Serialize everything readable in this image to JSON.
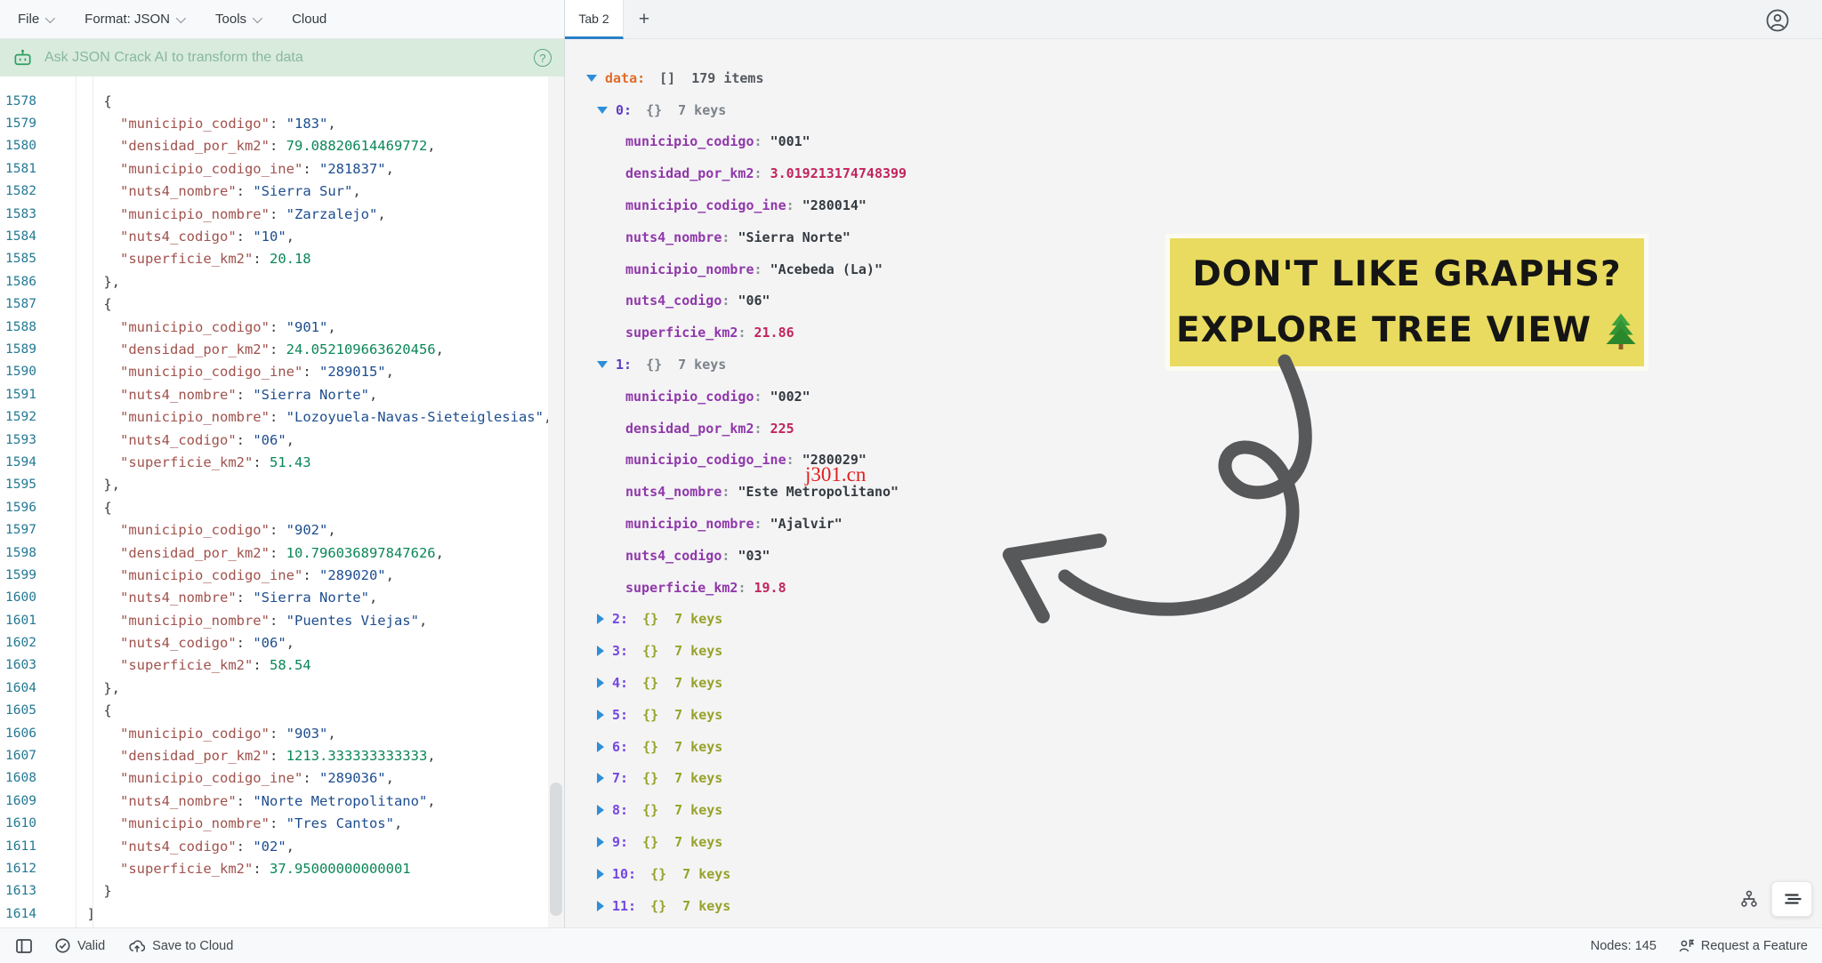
{
  "menu": {
    "items": [
      {
        "label": "File",
        "chevron": true
      },
      {
        "label": "Format: JSON",
        "chevron": true
      },
      {
        "label": "Tools",
        "chevron": true
      },
      {
        "label": "Cloud",
        "chevron": false
      }
    ]
  },
  "ai_banner": {
    "label": "Ask JSON Crack AI to transform the data",
    "help": "?"
  },
  "tabs": {
    "active": "Tab 2",
    "add": "+"
  },
  "editor": {
    "lines": [
      {
        "n": 1578,
        "p": "    {"
      },
      {
        "n": 1579,
        "k": "municipio_codigo",
        "v": "183",
        "t": "s",
        "c": true
      },
      {
        "n": 1580,
        "k": "densidad_por_km2",
        "v": "79.08820614469772",
        "t": "n",
        "c": true
      },
      {
        "n": 1581,
        "k": "municipio_codigo_ine",
        "v": "281837",
        "t": "s",
        "c": true
      },
      {
        "n": 1582,
        "k": "nuts4_nombre",
        "v": "Sierra Sur",
        "t": "s",
        "c": true
      },
      {
        "n": 1583,
        "k": "municipio_nombre",
        "v": "Zarzalejo",
        "t": "s",
        "c": true
      },
      {
        "n": 1584,
        "k": "nuts4_codigo",
        "v": "10",
        "t": "s",
        "c": true
      },
      {
        "n": 1585,
        "k": "superficie_km2",
        "v": "20.18",
        "t": "n",
        "c": false
      },
      {
        "n": 1586,
        "p": "    },"
      },
      {
        "n": 1587,
        "p": "    {"
      },
      {
        "n": 1588,
        "k": "municipio_codigo",
        "v": "901",
        "t": "s",
        "c": true
      },
      {
        "n": 1589,
        "k": "densidad_por_km2",
        "v": "24.052109663620456",
        "t": "n",
        "c": true
      },
      {
        "n": 1590,
        "k": "municipio_codigo_ine",
        "v": "289015",
        "t": "s",
        "c": true
      },
      {
        "n": 1591,
        "k": "nuts4_nombre",
        "v": "Sierra Norte",
        "t": "s",
        "c": true
      },
      {
        "n": 1592,
        "k": "municipio_nombre",
        "v": "Lozoyuela-Navas-Sieteiglesias",
        "t": "s",
        "c": true
      },
      {
        "n": 1593,
        "k": "nuts4_codigo",
        "v": "06",
        "t": "s",
        "c": true
      },
      {
        "n": 1594,
        "k": "superficie_km2",
        "v": "51.43",
        "t": "n",
        "c": false
      },
      {
        "n": 1595,
        "p": "    },"
      },
      {
        "n": 1596,
        "p": "    {"
      },
      {
        "n": 1597,
        "k": "municipio_codigo",
        "v": "902",
        "t": "s",
        "c": true
      },
      {
        "n": 1598,
        "k": "densidad_por_km2",
        "v": "10.796036897847626",
        "t": "n",
        "c": true
      },
      {
        "n": 1599,
        "k": "municipio_codigo_ine",
        "v": "289020",
        "t": "s",
        "c": true
      },
      {
        "n": 1600,
        "k": "nuts4_nombre",
        "v": "Sierra Norte",
        "t": "s",
        "c": true
      },
      {
        "n": 1601,
        "k": "municipio_nombre",
        "v": "Puentes Viejas",
        "t": "s",
        "c": true
      },
      {
        "n": 1602,
        "k": "nuts4_codigo",
        "v": "06",
        "t": "s",
        "c": true
      },
      {
        "n": 1603,
        "k": "superficie_km2",
        "v": "58.54",
        "t": "n",
        "c": false
      },
      {
        "n": 1604,
        "p": "    },"
      },
      {
        "n": 1605,
        "p": "    {"
      },
      {
        "n": 1606,
        "k": "municipio_codigo",
        "v": "903",
        "t": "s",
        "c": true
      },
      {
        "n": 1607,
        "k": "densidad_por_km2",
        "v": "1213.333333333333",
        "t": "n",
        "c": true
      },
      {
        "n": 1608,
        "k": "municipio_codigo_ine",
        "v": "289036",
        "t": "s",
        "c": true
      },
      {
        "n": 1609,
        "k": "nuts4_nombre",
        "v": "Norte Metropolitano",
        "t": "s",
        "c": true
      },
      {
        "n": 1610,
        "k": "municipio_nombre",
        "v": "Tres Cantos",
        "t": "s",
        "c": true
      },
      {
        "n": 1611,
        "k": "nuts4_codigo",
        "v": "02",
        "t": "s",
        "c": true
      },
      {
        "n": 1612,
        "k": "superficie_km2",
        "v": "37.95000000000001",
        "t": "n",
        "c": false
      },
      {
        "n": 1613,
        "p": "    }"
      },
      {
        "n": 1614,
        "p": "  ]"
      }
    ]
  },
  "tree": {
    "rows": [
      {
        "kind": "root",
        "key": "data",
        "badge": "[]",
        "meta": "179 items"
      },
      {
        "kind": "open",
        "key": "0",
        "badge": "{}",
        "meta": "7 keys"
      },
      {
        "kind": "kv",
        "key": "municipio_codigo",
        "v": "001",
        "t": "s"
      },
      {
        "kind": "kv",
        "key": "densidad_por_km2",
        "v": "3.019213174748399",
        "t": "n"
      },
      {
        "kind": "kv",
        "key": "municipio_codigo_ine",
        "v": "280014",
        "t": "s"
      },
      {
        "kind": "kv",
        "key": "nuts4_nombre",
        "v": "Sierra Norte",
        "t": "s"
      },
      {
        "kind": "kv",
        "key": "municipio_nombre",
        "v": "Acebeda (La)",
        "t": "s"
      },
      {
        "kind": "kv",
        "key": "nuts4_codigo",
        "v": "06",
        "t": "s"
      },
      {
        "kind": "kv",
        "key": "superficie_km2",
        "v": "21.86",
        "t": "n"
      },
      {
        "kind": "open",
        "key": "1",
        "badge": "{}",
        "meta": "7 keys"
      },
      {
        "kind": "kv",
        "key": "municipio_codigo",
        "v": "002",
        "t": "s"
      },
      {
        "kind": "kv",
        "key": "densidad_por_km2",
        "v": "225",
        "t": "n"
      },
      {
        "kind": "kv",
        "key": "municipio_codigo_ine",
        "v": "280029",
        "t": "s"
      },
      {
        "kind": "kv",
        "key": "nuts4_nombre",
        "v": "Este Metropolitano",
        "t": "s"
      },
      {
        "kind": "kv",
        "key": "municipio_nombre",
        "v": "Ajalvir",
        "t": "s"
      },
      {
        "kind": "kv",
        "key": "nuts4_codigo",
        "v": "03",
        "t": "s"
      },
      {
        "kind": "kv",
        "key": "superficie_km2",
        "v": "19.8",
        "t": "n"
      },
      {
        "kind": "closed",
        "key": "2",
        "badge": "{}",
        "meta": "7 keys"
      },
      {
        "kind": "closed",
        "key": "3",
        "badge": "{}",
        "meta": "7 keys"
      },
      {
        "kind": "closed",
        "key": "4",
        "badge": "{}",
        "meta": "7 keys"
      },
      {
        "kind": "closed",
        "key": "5",
        "badge": "{}",
        "meta": "7 keys"
      },
      {
        "kind": "closed",
        "key": "6",
        "badge": "{}",
        "meta": "7 keys"
      },
      {
        "kind": "closed",
        "key": "7",
        "badge": "{}",
        "meta": "7 keys"
      },
      {
        "kind": "closed",
        "key": "8",
        "badge": "{}",
        "meta": "7 keys"
      },
      {
        "kind": "closed",
        "key": "9",
        "badge": "{}",
        "meta": "7 keys"
      },
      {
        "kind": "closed",
        "key": "10",
        "badge": "{}",
        "meta": "7 keys"
      },
      {
        "kind": "closed",
        "key": "11",
        "badge": "{}",
        "meta": "7 keys"
      }
    ]
  },
  "sticker": {
    "line1": "DON'T LIKE GRAPHS?",
    "line2": "EXPLORE TREE VIEW",
    "icon": "tree-emoji"
  },
  "watermark": "j301.cn",
  "statusbar": {
    "valid": "Valid",
    "save": "Save to Cloud",
    "nodes": "Nodes: 145",
    "request": "Request a Feature"
  },
  "colors": {
    "accent_blue": "#2a80c6",
    "caret_blue": "#2d8fd9",
    "data_orange": "#e06d2a",
    "index_purple": "#7547e0",
    "key_purple": "#9038aa",
    "num_pink": "#c2255c",
    "collapsed_olive": "#97a32a",
    "editor_key_red": "#a0524d",
    "editor_str_blue": "#1d4d8f",
    "editor_num_green": "#0a8657",
    "banner_green": "#d9ebdd",
    "sticker_yellow": "#e8db5f",
    "watermark_red": "#e01f1f"
  }
}
